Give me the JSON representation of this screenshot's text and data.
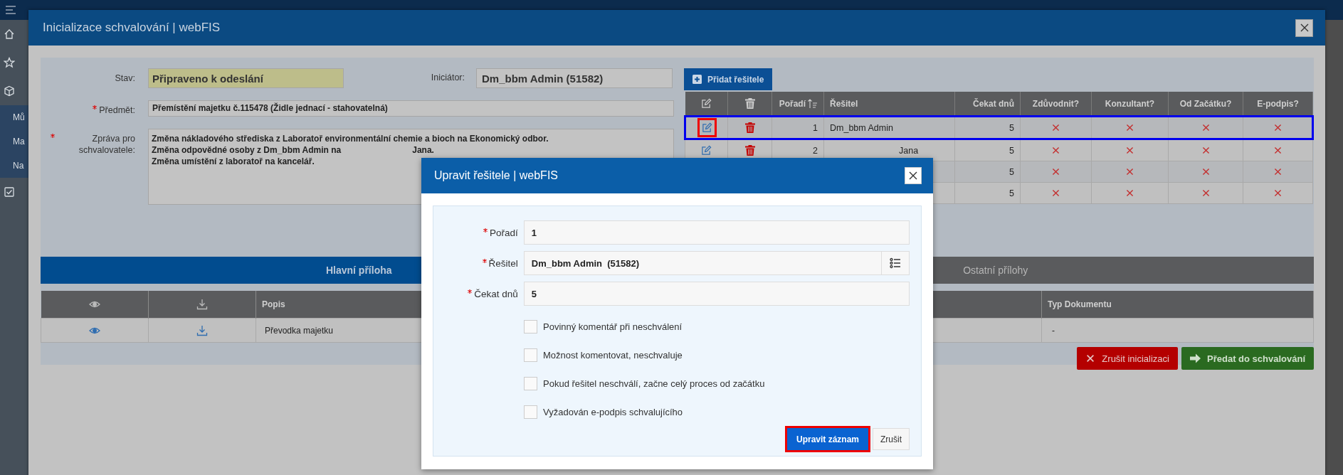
{
  "sidebar": {
    "items": [
      {
        "label": "Mů"
      },
      {
        "label": "Ma"
      },
      {
        "label": "Na"
      }
    ]
  },
  "main_dialog": {
    "title": "Inicializace schvalování | webFIS",
    "form": {
      "status": {
        "label": "Stav:",
        "value": "Připraveno k odeslání"
      },
      "initiator": {
        "label": "Iniciátor:",
        "value": "Dm_bbm Admin (51582)"
      },
      "subject": {
        "label": "Předmět:",
        "required": true,
        "value": "Přemístění majetku č.115478 (Židle jednací - stahovatelná)"
      },
      "message": {
        "label": "Zpráva pro schvalovatele:",
        "required": true,
        "lines": [
          [
            "Změna nákladového střediska z Laboratoř environmentální chemie a bioch na Ekonomický odbor."
          ],
          [
            "Změna odpovědné osoby z Dm_bbm Admin na",
            "Jana."
          ],
          [
            "Změna umístění z laboratoř na kancelář."
          ]
        ]
      }
    },
    "add_button": "Přidat řešitele",
    "solvers": {
      "columns": [
        "Pořadí",
        "Řešitel",
        "Čekat dnů",
        "Zdůvodnit?",
        "Konzultant?",
        "Od Začátku?",
        "E-podpis?"
      ],
      "rows": [
        {
          "order": "1",
          "solver": "Dm_bbm Admin",
          "days": "5",
          "justify": false,
          "consultant": false,
          "from_start": false,
          "esign": false,
          "highlighted": true
        },
        {
          "order": "2",
          "solver": "Jana",
          "days": "5",
          "justify": false,
          "consultant": false,
          "from_start": false,
          "esign": false,
          "highlighted": false
        },
        {
          "days": "5",
          "justify": false,
          "consultant": false,
          "from_start": false,
          "esign": false,
          "highlighted": false
        },
        {
          "days": "5",
          "justify": false,
          "consultant": false,
          "from_start": false,
          "esign": false,
          "highlighted": false
        }
      ]
    },
    "attachment_tabs": [
      {
        "label": "Hlavní příloha",
        "selected": true
      },
      {
        "label": "Ostatní přílohy",
        "selected": false
      }
    ],
    "attachments": {
      "columns": [
        "Popis",
        "Typ Dokumentu"
      ],
      "rows": [
        {
          "description": "Převodka majetku",
          "type": "-"
        }
      ]
    },
    "buttons": [
      {
        "label": "Zrušit inicializaci",
        "kind": "cancel"
      },
      {
        "label": "Předat do schvalování",
        "kind": "submit"
      }
    ]
  },
  "edit_dialog": {
    "title": "Upravit řešitele | webFIS",
    "fields": [
      {
        "label": "Pořadí",
        "value": "1",
        "required": true,
        "picker": false
      },
      {
        "label": "Řešitel",
        "value": "Dm_bbm Admin  (51582)",
        "required": true,
        "picker": true
      },
      {
        "label": "Čekat dnů",
        "value": "5",
        "required": true,
        "picker": false
      }
    ],
    "checkboxes": [
      {
        "label": "Povinný komentář při neschválení",
        "checked": false
      },
      {
        "label": "Možnost komentovat, neschvaluje",
        "checked": false
      },
      {
        "label": "Pokud řešitel neschválí, začne celý proces od začátku",
        "checked": false
      },
      {
        "label": "Vyžadován e-podpis schvalujícího",
        "checked": false
      }
    ],
    "buttons": [
      {
        "label": "Upravit záznam",
        "kind": "primary",
        "marked": true
      },
      {
        "label": "Zrušit",
        "kind": "secondary",
        "marked": false
      }
    ]
  }
}
